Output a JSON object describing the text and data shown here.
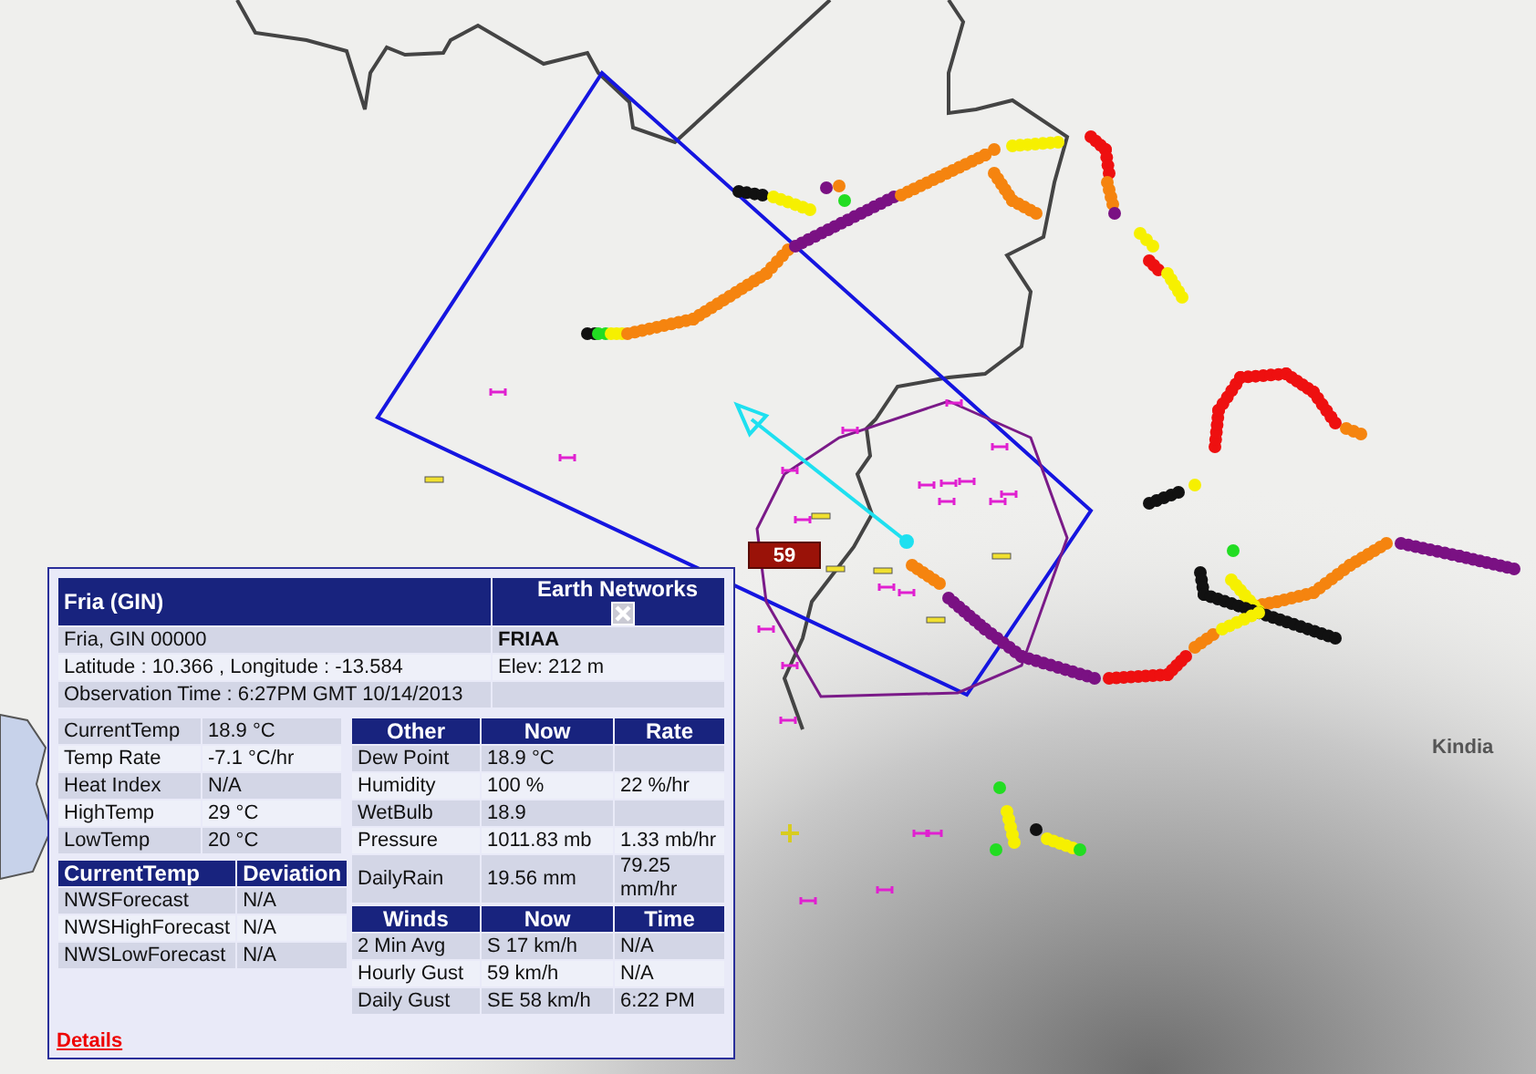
{
  "map": {
    "place_labels": [
      {
        "text": "Kindia"
      }
    ],
    "markers": [
      {
        "text": "59"
      }
    ]
  },
  "popup": {
    "title": "Fria (GIN)",
    "network": "Earth Networks",
    "location": "Fria, GIN 00000",
    "station_id": "FRIAA",
    "coordinates": "Latitude :  10.366 ,  Longitude :  -13.584",
    "elevation": "Elev: 212 m",
    "observation_time": "Observation Time : 6:27PM GMT 10/14/2013",
    "temperature_table": {
      "rows": [
        [
          "CurrentTemp",
          "18.9 °C"
        ],
        [
          "Temp Rate",
          "-7.1 °C/hr"
        ],
        [
          "Heat Index",
          "N/A"
        ],
        [
          "HighTemp",
          "29 °C"
        ],
        [
          "LowTemp",
          "20 °C"
        ]
      ]
    },
    "forecast_table": {
      "columns": [
        "CurrentTemp",
        "Deviation"
      ],
      "rows": [
        [
          "NWSForecast",
          "N/A"
        ],
        [
          "NWSHighForecast",
          "N/A"
        ],
        [
          "NWSLowForecast",
          "N/A"
        ]
      ]
    },
    "other_table": {
      "columns": [
        "Other",
        "Now",
        "Rate"
      ],
      "rows": [
        [
          "Dew Point",
          "18.9 °C",
          ""
        ],
        [
          "Humidity",
          "100 %",
          "22 %/hr"
        ],
        [
          "WetBulb",
          "18.9",
          ""
        ],
        [
          "Pressure",
          "1011.83 mb",
          "1.33 mb/hr"
        ],
        [
          "DailyRain",
          "19.56 mm",
          "79.25 mm/hr"
        ]
      ]
    },
    "winds_table": {
      "columns": [
        "Winds",
        "Now",
        "Time"
      ],
      "rows": [
        [
          "2 Min Avg",
          "S 17 km/h",
          "N/A"
        ],
        [
          "Hourly Gust",
          " 59 km/h",
          "N/A"
        ],
        [
          "Daily Gust",
          "SE 58 km/h",
          "6:22 PM"
        ]
      ]
    },
    "details_link": "Details"
  }
}
